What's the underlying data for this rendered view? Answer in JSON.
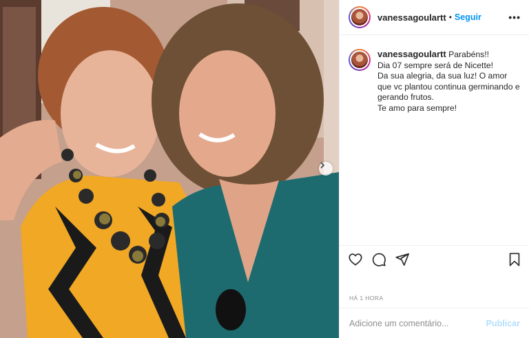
{
  "post": {
    "username": "vanessagoulartt",
    "follow_label": "Seguir",
    "more_label": "•••",
    "caption": {
      "username": "vanessagoulartt",
      "lines": [
        "Parabéns!!",
        "Dia 07 sempre será de Nicette!",
        "Da sua alegria, da sua luz! O amor que vc plantou continua germinando e gerando frutos.",
        "Te amo para sempre!"
      ]
    },
    "time": "HÁ 1 HORA",
    "comment": {
      "placeholder": "Adicione um comentário...",
      "publish_label": "Publicar"
    }
  },
  "icons": {
    "like": "heart-icon",
    "comment": "comment-icon",
    "share": "share-icon",
    "save": "bookmark-icon",
    "next": "chevron-right-icon"
  },
  "colors": {
    "accent": "#0095f6",
    "publish_disabled": "#b2dffc",
    "muted": "#8e8e8e"
  }
}
